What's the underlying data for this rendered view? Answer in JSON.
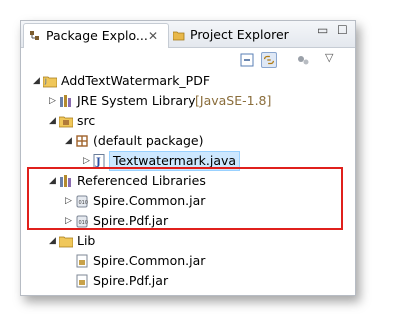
{
  "tabs": {
    "package_explorer": "Package Explo...",
    "close_symbol": "✕",
    "project_explorer": "Project Explorer",
    "minimize_symbol": "▭",
    "maximize_symbol": "☐"
  },
  "tree": {
    "project": "AddTextWatermark_PDF",
    "jre_library": "JRE System Library",
    "jre_version": "[JavaSE-1.8]",
    "src": "src",
    "default_package": "(default package)",
    "java_file": "Textwatermark.java",
    "referenced_libraries": "Referenced Libraries",
    "ref_jar_1": "Spire.Common.jar",
    "ref_jar_2": "Spire.Pdf.jar",
    "lib_folder": "Lib",
    "lib_jar_1": "Spire.Common.jar",
    "lib_jar_2": "Spire.Pdf.jar"
  },
  "icons": {
    "expanded": "◢",
    "collapsed": "▷"
  },
  "colors": {
    "highlight_box": "#e0201c",
    "selection": "#cde8ff"
  }
}
